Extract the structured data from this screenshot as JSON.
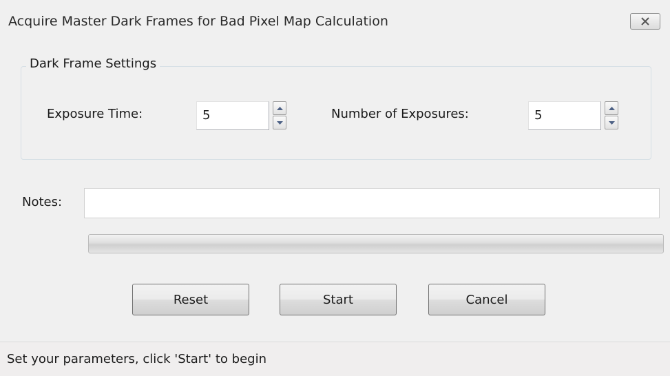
{
  "window": {
    "title": "Acquire Master Dark Frames for Bad Pixel Map Calculation",
    "close_icon": "close-x-icon"
  },
  "dark_frame_settings": {
    "legend": "Dark Frame Settings",
    "exposure_time_label": "Exposure Time:",
    "exposure_time_value": "5",
    "number_of_exposures_label": "Number of Exposures:",
    "number_of_exposures_value": "5",
    "spin_up_icon": "arrow-up-icon",
    "spin_down_icon": "arrow-down-icon"
  },
  "notes": {
    "label": "Notes:",
    "value": ""
  },
  "progress": {
    "percent": 0
  },
  "buttons": {
    "reset": "Reset",
    "start": "Start",
    "cancel": "Cancel"
  },
  "status": {
    "text": "Set your parameters, click 'Start' to begin"
  },
  "colors": {
    "window_bg": "#f0f0f0",
    "status_bg": "#f0eeee",
    "group_border": "#d5dfe5"
  }
}
